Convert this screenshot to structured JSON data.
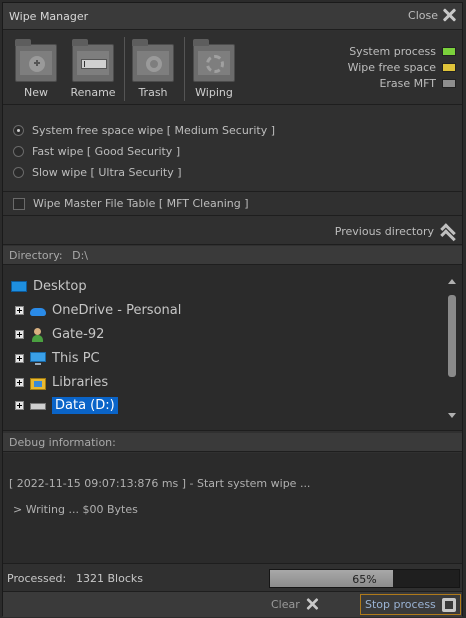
{
  "window": {
    "title": "Wipe Manager",
    "close_label": "Close"
  },
  "toolbar": {
    "buttons": [
      {
        "label": "New",
        "icon": "new-folder-icon"
      },
      {
        "label": "Rename",
        "icon": "rename-folder-icon"
      },
      {
        "label": "Trash",
        "icon": "trash-folder-icon"
      },
      {
        "label": "Wiping",
        "icon": "wiping-folder-icon"
      }
    ]
  },
  "legend": [
    {
      "label": "System process",
      "color": "#7bd13c"
    },
    {
      "label": "Wipe free space",
      "color": "#e0c43a"
    },
    {
      "label": "Erase MFT",
      "color": "#8e8e8e"
    }
  ],
  "options": {
    "radios": [
      {
        "label": "System free space wipe [ Medium Security ]",
        "selected": true
      },
      {
        "label": "Fast wipe [ Good Security ]",
        "selected": false
      },
      {
        "label": "Slow wipe [ Ultra Security ]",
        "selected": false
      }
    ],
    "mft_checkbox": {
      "label": "Wipe Master File Table [ MFT Cleaning ]",
      "checked": false
    }
  },
  "navigation": {
    "previous_directory": "Previous directory"
  },
  "directory": {
    "label": "Directory:",
    "path": "D:\\"
  },
  "tree": {
    "root": "Desktop",
    "items": [
      {
        "label": "OneDrive - Personal",
        "icon": "onedrive-icon"
      },
      {
        "label": "Gate-92",
        "icon": "user-icon"
      },
      {
        "label": "This PC",
        "icon": "computer-icon"
      },
      {
        "label": "Libraries",
        "icon": "libraries-icon"
      },
      {
        "label": "Data (D:)",
        "icon": "drive-icon",
        "selected": true
      }
    ]
  },
  "debug": {
    "header": "Debug information:",
    "lines": [
      "[ 2022-11-15  09:07:13:876 ms ] - Start system wipe ...",
      "> Writing ... $00 Bytes"
    ]
  },
  "status": {
    "processed_label": "Processed:",
    "processed_value": "1321 Blocks",
    "progress_text": "65%",
    "progress": 0.65
  },
  "footer": {
    "clear_label": "Clear",
    "stop_label": "Stop process"
  }
}
